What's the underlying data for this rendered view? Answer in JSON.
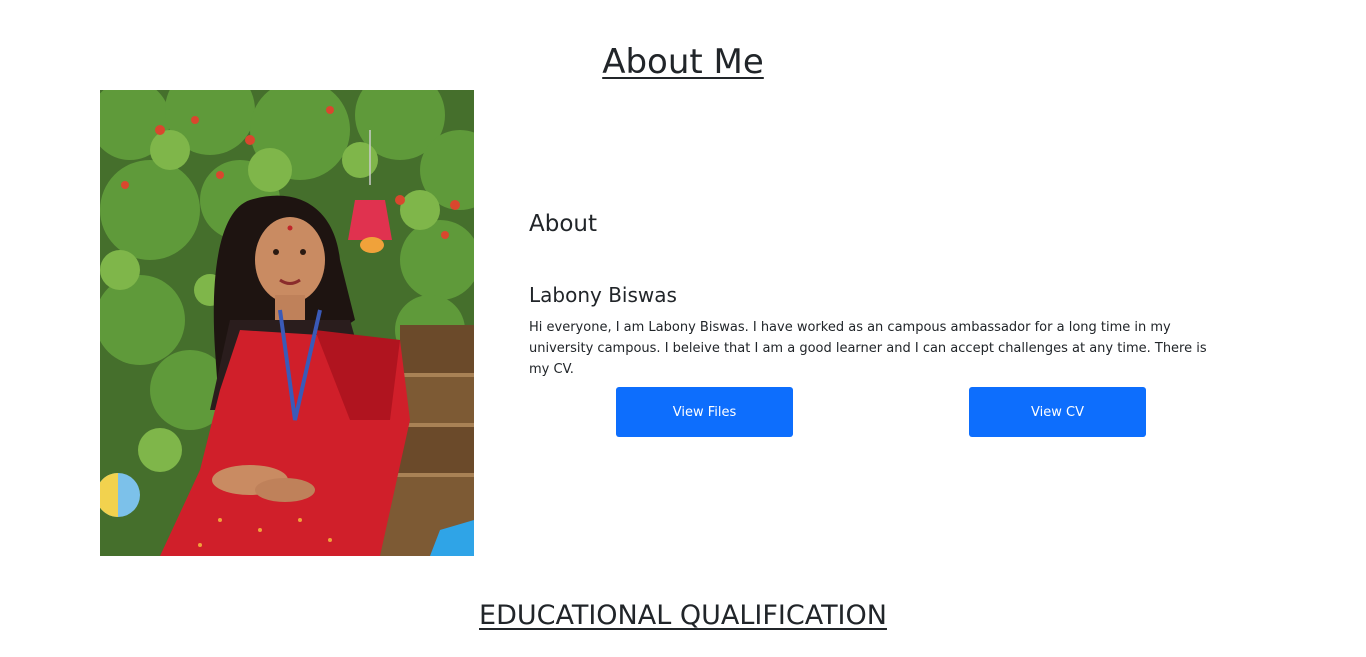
{
  "about_section": {
    "title": "About Me",
    "subtitle": "About",
    "name": "Labony Biswas",
    "bio": "Hi everyone, I am Labony Biswas. I have worked as an campous ambassador for a long time in my university campous. I beleive that I am a good learner and I can accept challenges at any time. There is my CV.",
    "buttons": {
      "view_files": "View Files",
      "view_cv": "View CV"
    }
  },
  "education_section": {
    "title": "EDUCATIONAL QUALIFICATION"
  },
  "colors": {
    "accent": "#0d6efd",
    "text": "#212529",
    "background": "#ffffff"
  }
}
